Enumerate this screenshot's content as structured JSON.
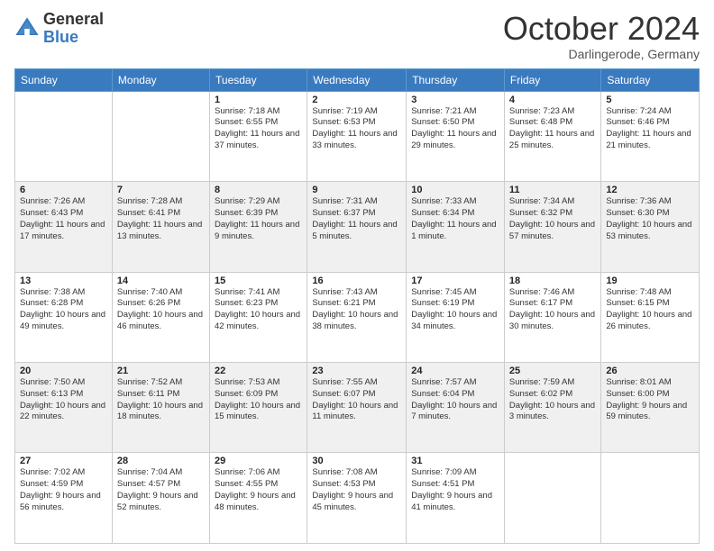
{
  "logo": {
    "general": "General",
    "blue": "Blue"
  },
  "title": "October 2024",
  "location": "Darlingerode, Germany",
  "days_of_week": [
    "Sunday",
    "Monday",
    "Tuesday",
    "Wednesday",
    "Thursday",
    "Friday",
    "Saturday"
  ],
  "weeks": [
    [
      {
        "day": "",
        "detail": ""
      },
      {
        "day": "",
        "detail": ""
      },
      {
        "day": "1",
        "detail": "Sunrise: 7:18 AM\nSunset: 6:55 PM\nDaylight: 11 hours and 37 minutes."
      },
      {
        "day": "2",
        "detail": "Sunrise: 7:19 AM\nSunset: 6:53 PM\nDaylight: 11 hours and 33 minutes."
      },
      {
        "day": "3",
        "detail": "Sunrise: 7:21 AM\nSunset: 6:50 PM\nDaylight: 11 hours and 29 minutes."
      },
      {
        "day": "4",
        "detail": "Sunrise: 7:23 AM\nSunset: 6:48 PM\nDaylight: 11 hours and 25 minutes."
      },
      {
        "day": "5",
        "detail": "Sunrise: 7:24 AM\nSunset: 6:46 PM\nDaylight: 11 hours and 21 minutes."
      }
    ],
    [
      {
        "day": "6",
        "detail": "Sunrise: 7:26 AM\nSunset: 6:43 PM\nDaylight: 11 hours and 17 minutes."
      },
      {
        "day": "7",
        "detail": "Sunrise: 7:28 AM\nSunset: 6:41 PM\nDaylight: 11 hours and 13 minutes."
      },
      {
        "day": "8",
        "detail": "Sunrise: 7:29 AM\nSunset: 6:39 PM\nDaylight: 11 hours and 9 minutes."
      },
      {
        "day": "9",
        "detail": "Sunrise: 7:31 AM\nSunset: 6:37 PM\nDaylight: 11 hours and 5 minutes."
      },
      {
        "day": "10",
        "detail": "Sunrise: 7:33 AM\nSunset: 6:34 PM\nDaylight: 11 hours and 1 minute."
      },
      {
        "day": "11",
        "detail": "Sunrise: 7:34 AM\nSunset: 6:32 PM\nDaylight: 10 hours and 57 minutes."
      },
      {
        "day": "12",
        "detail": "Sunrise: 7:36 AM\nSunset: 6:30 PM\nDaylight: 10 hours and 53 minutes."
      }
    ],
    [
      {
        "day": "13",
        "detail": "Sunrise: 7:38 AM\nSunset: 6:28 PM\nDaylight: 10 hours and 49 minutes."
      },
      {
        "day": "14",
        "detail": "Sunrise: 7:40 AM\nSunset: 6:26 PM\nDaylight: 10 hours and 46 minutes."
      },
      {
        "day": "15",
        "detail": "Sunrise: 7:41 AM\nSunset: 6:23 PM\nDaylight: 10 hours and 42 minutes."
      },
      {
        "day": "16",
        "detail": "Sunrise: 7:43 AM\nSunset: 6:21 PM\nDaylight: 10 hours and 38 minutes."
      },
      {
        "day": "17",
        "detail": "Sunrise: 7:45 AM\nSunset: 6:19 PM\nDaylight: 10 hours and 34 minutes."
      },
      {
        "day": "18",
        "detail": "Sunrise: 7:46 AM\nSunset: 6:17 PM\nDaylight: 10 hours and 30 minutes."
      },
      {
        "day": "19",
        "detail": "Sunrise: 7:48 AM\nSunset: 6:15 PM\nDaylight: 10 hours and 26 minutes."
      }
    ],
    [
      {
        "day": "20",
        "detail": "Sunrise: 7:50 AM\nSunset: 6:13 PM\nDaylight: 10 hours and 22 minutes."
      },
      {
        "day": "21",
        "detail": "Sunrise: 7:52 AM\nSunset: 6:11 PM\nDaylight: 10 hours and 18 minutes."
      },
      {
        "day": "22",
        "detail": "Sunrise: 7:53 AM\nSunset: 6:09 PM\nDaylight: 10 hours and 15 minutes."
      },
      {
        "day": "23",
        "detail": "Sunrise: 7:55 AM\nSunset: 6:07 PM\nDaylight: 10 hours and 11 minutes."
      },
      {
        "day": "24",
        "detail": "Sunrise: 7:57 AM\nSunset: 6:04 PM\nDaylight: 10 hours and 7 minutes."
      },
      {
        "day": "25",
        "detail": "Sunrise: 7:59 AM\nSunset: 6:02 PM\nDaylight: 10 hours and 3 minutes."
      },
      {
        "day": "26",
        "detail": "Sunrise: 8:01 AM\nSunset: 6:00 PM\nDaylight: 9 hours and 59 minutes."
      }
    ],
    [
      {
        "day": "27",
        "detail": "Sunrise: 7:02 AM\nSunset: 4:59 PM\nDaylight: 9 hours and 56 minutes."
      },
      {
        "day": "28",
        "detail": "Sunrise: 7:04 AM\nSunset: 4:57 PM\nDaylight: 9 hours and 52 minutes."
      },
      {
        "day": "29",
        "detail": "Sunrise: 7:06 AM\nSunset: 4:55 PM\nDaylight: 9 hours and 48 minutes."
      },
      {
        "day": "30",
        "detail": "Sunrise: 7:08 AM\nSunset: 4:53 PM\nDaylight: 9 hours and 45 minutes."
      },
      {
        "day": "31",
        "detail": "Sunrise: 7:09 AM\nSunset: 4:51 PM\nDaylight: 9 hours and 41 minutes."
      },
      {
        "day": "",
        "detail": ""
      },
      {
        "day": "",
        "detail": ""
      }
    ]
  ]
}
